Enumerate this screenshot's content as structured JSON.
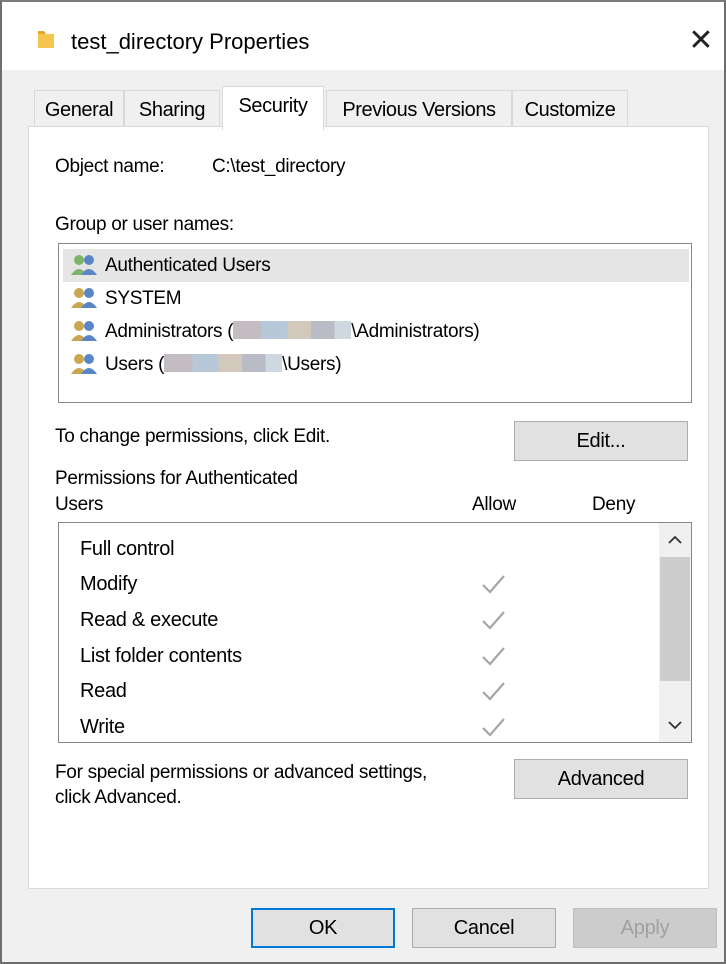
{
  "window": {
    "title": "test_directory Properties",
    "close_glyph": "✕"
  },
  "tabs": [
    {
      "label": "General"
    },
    {
      "label": "Sharing"
    },
    {
      "label": "Security"
    },
    {
      "label": "Previous Versions"
    },
    {
      "label": "Customize"
    }
  ],
  "active_tab": "Security",
  "security": {
    "object_name_label": "Object name:",
    "object_name_value": "C:\\test_directory",
    "group_label": "Group or user names:",
    "users": [
      {
        "prefix": "Authenticated Users",
        "suffix": "",
        "selected": true
      },
      {
        "prefix": "SYSTEM",
        "suffix": "",
        "selected": false
      },
      {
        "prefix": "Administrators (",
        "suffix": "\\Administrators)",
        "selected": false
      },
      {
        "prefix": "Users (",
        "suffix": "\\Users)",
        "selected": false
      }
    ],
    "change_hint": "To change permissions, click Edit.",
    "edit_button": "Edit...",
    "perm_header_line1": "Permissions for Authenticated",
    "perm_header_line2": "Users",
    "allow_label": "Allow",
    "deny_label": "Deny",
    "permissions": [
      {
        "name": "Full control",
        "allow": false,
        "deny": false
      },
      {
        "name": "Modify",
        "allow": true,
        "deny": false
      },
      {
        "name": "Read & execute",
        "allow": true,
        "deny": false
      },
      {
        "name": "List folder contents",
        "allow": true,
        "deny": false
      },
      {
        "name": "Read",
        "allow": true,
        "deny": false
      },
      {
        "name": "Write",
        "allow": true,
        "deny": false
      }
    ],
    "special_hint_line1": "For special permissions or advanced settings,",
    "special_hint_line2": "click Advanced.",
    "advanced_button": "Advanced"
  },
  "footer": {
    "ok": "OK",
    "cancel": "Cancel",
    "apply": "Apply"
  },
  "colors": {
    "accent": "#0078d7",
    "check": "#a6a6a6",
    "selected_row": "#e5e5e5",
    "folder": "#f4c64f"
  }
}
